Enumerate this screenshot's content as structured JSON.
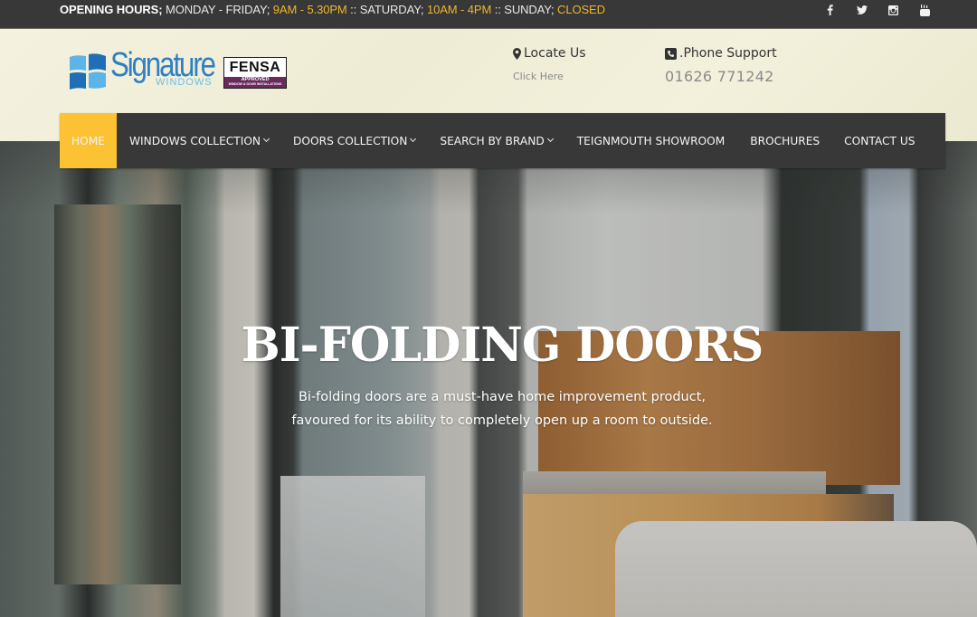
{
  "topbar": {
    "hours_label": "OPENING HOURS;",
    "weekday_label": " MONDAY - FRIDAY; ",
    "weekday_hours": "9AM - 5.30PM",
    "saturday_label": " :: SATURDAY; ",
    "saturday_hours": "10AM - 4PM",
    "sunday_label": " :: SUNDAY; ",
    "sunday_hours": "CLOSED",
    "highlight_color": "#f0b52c",
    "social": [
      {
        "name": "facebook-icon"
      },
      {
        "name": "twitter-icon"
      },
      {
        "name": "instagram-icon"
      },
      {
        "name": "youtube-icon"
      }
    ]
  },
  "header": {
    "logo_main": "Signature",
    "logo_sub": "WINDOWS",
    "fensa_title": "FENSA",
    "fensa_badge": "APPROVED",
    "fensa_badge_sub": "WINDOW & DOOR INSTALLATIONS",
    "locate_title": "Locate Us",
    "locate_link": "Click Here",
    "phone_title": ".Phone Support",
    "phone_number": "01626 771242"
  },
  "nav": {
    "items": [
      {
        "label": "HOME",
        "active": true
      },
      {
        "label": "WINDOWS COLLECTION",
        "dropdown": true
      },
      {
        "label": "DOORS COLLECTION",
        "dropdown": true
      },
      {
        "label": "SEARCH BY BRAND",
        "dropdown": true
      },
      {
        "label": "TEIGNMOUTH SHOWROOM"
      },
      {
        "label": "BROCHURES"
      },
      {
        "label": "CONTACT US"
      }
    ],
    "active_color": "#fcc233",
    "bg_color": "#383838"
  },
  "hero": {
    "title": "BI-FOLDING DOORS",
    "subtitle_line1": "Bi-folding doors are a must-have home improvement product,",
    "subtitle_line2": "favoured for its ability to completely open up a room to outside."
  }
}
